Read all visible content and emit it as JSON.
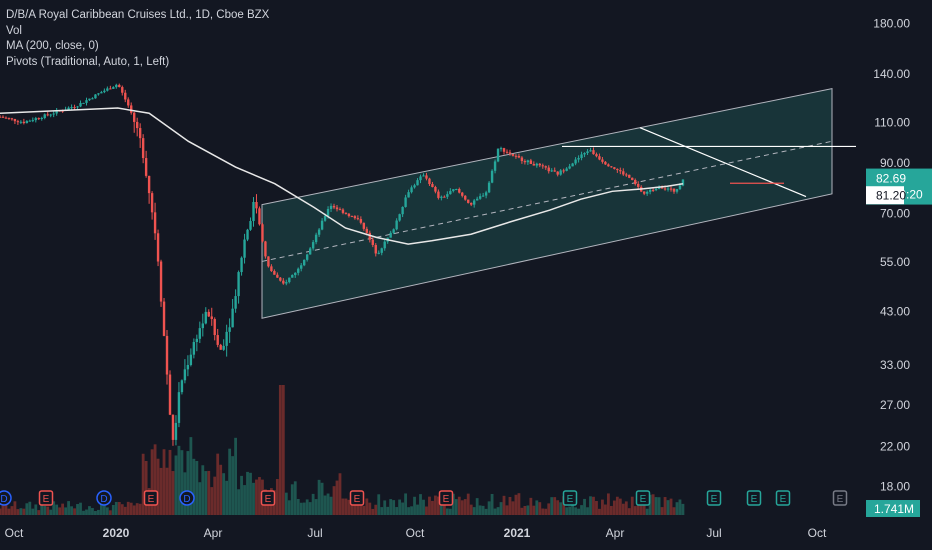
{
  "legend": {
    "title": "D/B/A Royal Caribbean Cruises Ltd., 1D, Cboe BZX",
    "vol": "Vol",
    "ma": "MA (200, close, 0)",
    "pivots": "Pivots (Traditional, Auto, 1, Left)"
  },
  "colors": {
    "background": "#131722",
    "up": "#26a69a",
    "down": "#ef5350",
    "channel_fill": "#1d4d4c",
    "channel_line": "#b2b5be",
    "ma_line": "#e8e8e8",
    "axis_text": "#d1d4dc",
    "volume_up": "#1e5650",
    "volume_down": "#6b2b2b"
  },
  "chart_data": {
    "type": "candlestick",
    "y_scale": "log",
    "ylim": [
      15.6,
      196
    ],
    "price_ticks": [
      "180.00",
      "140.00",
      "110.00",
      "90.00",
      "70.00",
      "55.00",
      "43.00",
      "33.00",
      "27.00",
      "22.00",
      "18.00"
    ],
    "time_ticks": [
      {
        "label": "Oct",
        "bold": false
      },
      {
        "label": "2020",
        "bold": true
      },
      {
        "label": "Apr",
        "bold": false
      },
      {
        "label": "Jul",
        "bold": false
      },
      {
        "label": "Oct",
        "bold": false
      },
      {
        "label": "2021",
        "bold": true
      },
      {
        "label": "Apr",
        "bold": false
      },
      {
        "label": "Jul",
        "bold": false
      },
      {
        "label": "Oct",
        "bold": false
      }
    ],
    "last_price": {
      "value": "82.69",
      "countdown": "01:03:20"
    },
    "reference_price": "81.20",
    "volume_label": "1.741M",
    "event_markers": [
      "D",
      "E",
      "D",
      "E",
      "D",
      "E",
      "E",
      "E",
      "E",
      "E",
      "E",
      "E",
      "E"
    ],
    "upcoming_marker": "E",
    "channel": {
      "lower_start": 41.5,
      "lower_end": 77,
      "upper_start": 73,
      "upper_end": 130
    },
    "horizontal_resistance": 97.5,
    "trendline": {
      "start": 107,
      "end": 76
    },
    "price_path": [
      {
        "t": 0,
        "p": 113
      },
      {
        "t": 0.03,
        "p": 110
      },
      {
        "t": 0.06,
        "p": 114
      },
      {
        "t": 0.1,
        "p": 120
      },
      {
        "t": 0.13,
        "p": 128
      },
      {
        "t": 0.15,
        "p": 133
      },
      {
        "t": 0.165,
        "p": 118
      },
      {
        "t": 0.18,
        "p": 100
      },
      {
        "t": 0.19,
        "p": 78
      },
      {
        "t": 0.2,
        "p": 60
      },
      {
        "t": 0.21,
        "p": 36
      },
      {
        "t": 0.22,
        "p": 22
      },
      {
        "t": 0.23,
        "p": 30
      },
      {
        "t": 0.25,
        "p": 38
      },
      {
        "t": 0.265,
        "p": 43
      },
      {
        "t": 0.28,
        "p": 35
      },
      {
        "t": 0.295,
        "p": 42
      },
      {
        "t": 0.31,
        "p": 60
      },
      {
        "t": 0.325,
        "p": 75
      },
      {
        "t": 0.34,
        "p": 54
      },
      {
        "t": 0.36,
        "p": 49
      },
      {
        "t": 0.38,
        "p": 53
      },
      {
        "t": 0.4,
        "p": 61
      },
      {
        "t": 0.42,
        "p": 73
      },
      {
        "t": 0.44,
        "p": 70
      },
      {
        "t": 0.46,
        "p": 67
      },
      {
        "t": 0.48,
        "p": 57
      },
      {
        "t": 0.5,
        "p": 64
      },
      {
        "t": 0.52,
        "p": 78
      },
      {
        "t": 0.54,
        "p": 85
      },
      {
        "t": 0.56,
        "p": 75
      },
      {
        "t": 0.58,
        "p": 79
      },
      {
        "t": 0.6,
        "p": 73
      },
      {
        "t": 0.62,
        "p": 78
      },
      {
        "t": 0.635,
        "p": 97
      },
      {
        "t": 0.66,
        "p": 92
      },
      {
        "t": 0.69,
        "p": 88
      },
      {
        "t": 0.71,
        "p": 85
      },
      {
        "t": 0.73,
        "p": 90
      },
      {
        "t": 0.75,
        "p": 96
      },
      {
        "t": 0.77,
        "p": 90
      },
      {
        "t": 0.8,
        "p": 84
      },
      {
        "t": 0.82,
        "p": 77
      },
      {
        "t": 0.84,
        "p": 80
      },
      {
        "t": 0.86,
        "p": 78
      },
      {
        "t": 0.87,
        "p": 82.69
      }
    ],
    "ma_path": [
      {
        "t": 0,
        "p": 115
      },
      {
        "t": 0.1,
        "p": 117
      },
      {
        "t": 0.15,
        "p": 118
      },
      {
        "t": 0.19,
        "p": 115
      },
      {
        "t": 0.24,
        "p": 100
      },
      {
        "t": 0.3,
        "p": 88
      },
      {
        "t": 0.35,
        "p": 81
      },
      {
        "t": 0.4,
        "p": 72
      },
      {
        "t": 0.44,
        "p": 65
      },
      {
        "t": 0.48,
        "p": 62
      },
      {
        "t": 0.52,
        "p": 60
      },
      {
        "t": 0.55,
        "p": 61
      },
      {
        "t": 0.6,
        "p": 63
      },
      {
        "t": 0.65,
        "p": 67
      },
      {
        "t": 0.7,
        "p": 71
      },
      {
        "t": 0.74,
        "p": 75
      },
      {
        "t": 0.78,
        "p": 78
      },
      {
        "t": 0.82,
        "p": 79
      },
      {
        "t": 0.85,
        "p": 80
      },
      {
        "t": 0.87,
        "p": 81
      }
    ]
  }
}
